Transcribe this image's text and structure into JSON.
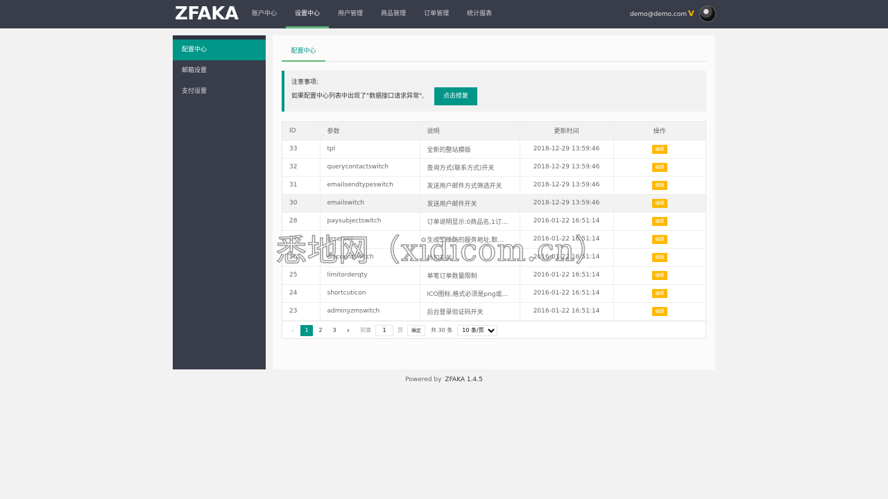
{
  "header": {
    "logo": "ZFAKA",
    "nav": [
      "账户中心",
      "设置中心",
      "用户管理",
      "商品管理",
      "订单管理",
      "统计报表"
    ],
    "active_nav": 1,
    "user_email": "demo@demo.com",
    "vip_mark": "V"
  },
  "sidebar": {
    "items": [
      {
        "label": "配置中心",
        "active": true
      },
      {
        "label": "邮箱设置",
        "active": false
      },
      {
        "label": "支付设置",
        "active": false
      }
    ]
  },
  "main": {
    "tab_label": "配置中心",
    "notice": {
      "title": "注意事项:",
      "text": "如果配置中心列表中出现了\"数据接口请求异常\",",
      "button": "点击修复"
    },
    "table": {
      "columns": [
        "ID",
        "参数",
        "说明",
        "更新时间",
        "操作"
      ],
      "rows": [
        {
          "id": "33",
          "param": "tpl",
          "desc": "全新的整站模版",
          "time": "2018-12-29 13:59:46",
          "op": "编辑"
        },
        {
          "id": "32",
          "param": "querycontactswitch",
          "desc": "查询方式(联系方式)开关",
          "time": "2018-12-29 13:59:46",
          "op": "编辑"
        },
        {
          "id": "31",
          "param": "emailsendtypeswitch",
          "desc": "发送用户邮件方式筛选开关",
          "time": "2018-12-29 13:59:46",
          "op": "编辑"
        },
        {
          "id": "30",
          "param": "emailswitch",
          "desc": "发送用户邮件开关",
          "time": "2018-12-29 13:59:46",
          "op": "编辑"
        },
        {
          "id": "28",
          "param": "paysubjectswitch",
          "desc": "订单说明显示:0商品名,1订…",
          "time": "2016-01-22 16:51:14",
          "op": "编辑"
        },
        {
          "id": "27",
          "param": "qrserver",
          "desc": "生成二维码的服务地址,默…",
          "time": "2016-01-22 16:51:14",
          "op": "编辑"
        },
        {
          "id": "26",
          "param": "discountswitch",
          "desc": "折扣开关",
          "time": "2016-01-22 16:51:14",
          "op": "编辑"
        },
        {
          "id": "25",
          "param": "limitorderqty",
          "desc": "单笔订单数量限制",
          "time": "2016-01-22 16:51:14",
          "op": "编辑"
        },
        {
          "id": "24",
          "param": "shortcuticon",
          "desc": "ICO图标,格式必须是png或…",
          "time": "2016-01-22 16:51:14",
          "op": "编辑"
        },
        {
          "id": "23",
          "param": "adminyzmswitch",
          "desc": "后台登录验证码开关",
          "time": "2016-01-22 16:51:14",
          "op": "编辑"
        }
      ],
      "highlight_row": 3
    },
    "pager": {
      "pages": [
        "1",
        "2",
        "3"
      ],
      "current": "1",
      "goto_label": "到第",
      "goto_value": "1",
      "goto_unit": "页",
      "confirm": "确定",
      "total": "共 30 条",
      "per_page": "10 条/页"
    }
  },
  "footer": {
    "powered": "Powered by",
    "version": "ZFAKA 1.4.5"
  },
  "watermark": "悉地网（xidicom.cn）",
  "colors": {
    "header_bg": "#393D49",
    "accent": "#009688",
    "tab_underline": "#5FB878",
    "edit_button": "#FFB800"
  },
  "icons": {
    "prev": "chevron-left-icon",
    "next": "chevron-right-icon",
    "dropdown": "chevron-down-icon"
  }
}
